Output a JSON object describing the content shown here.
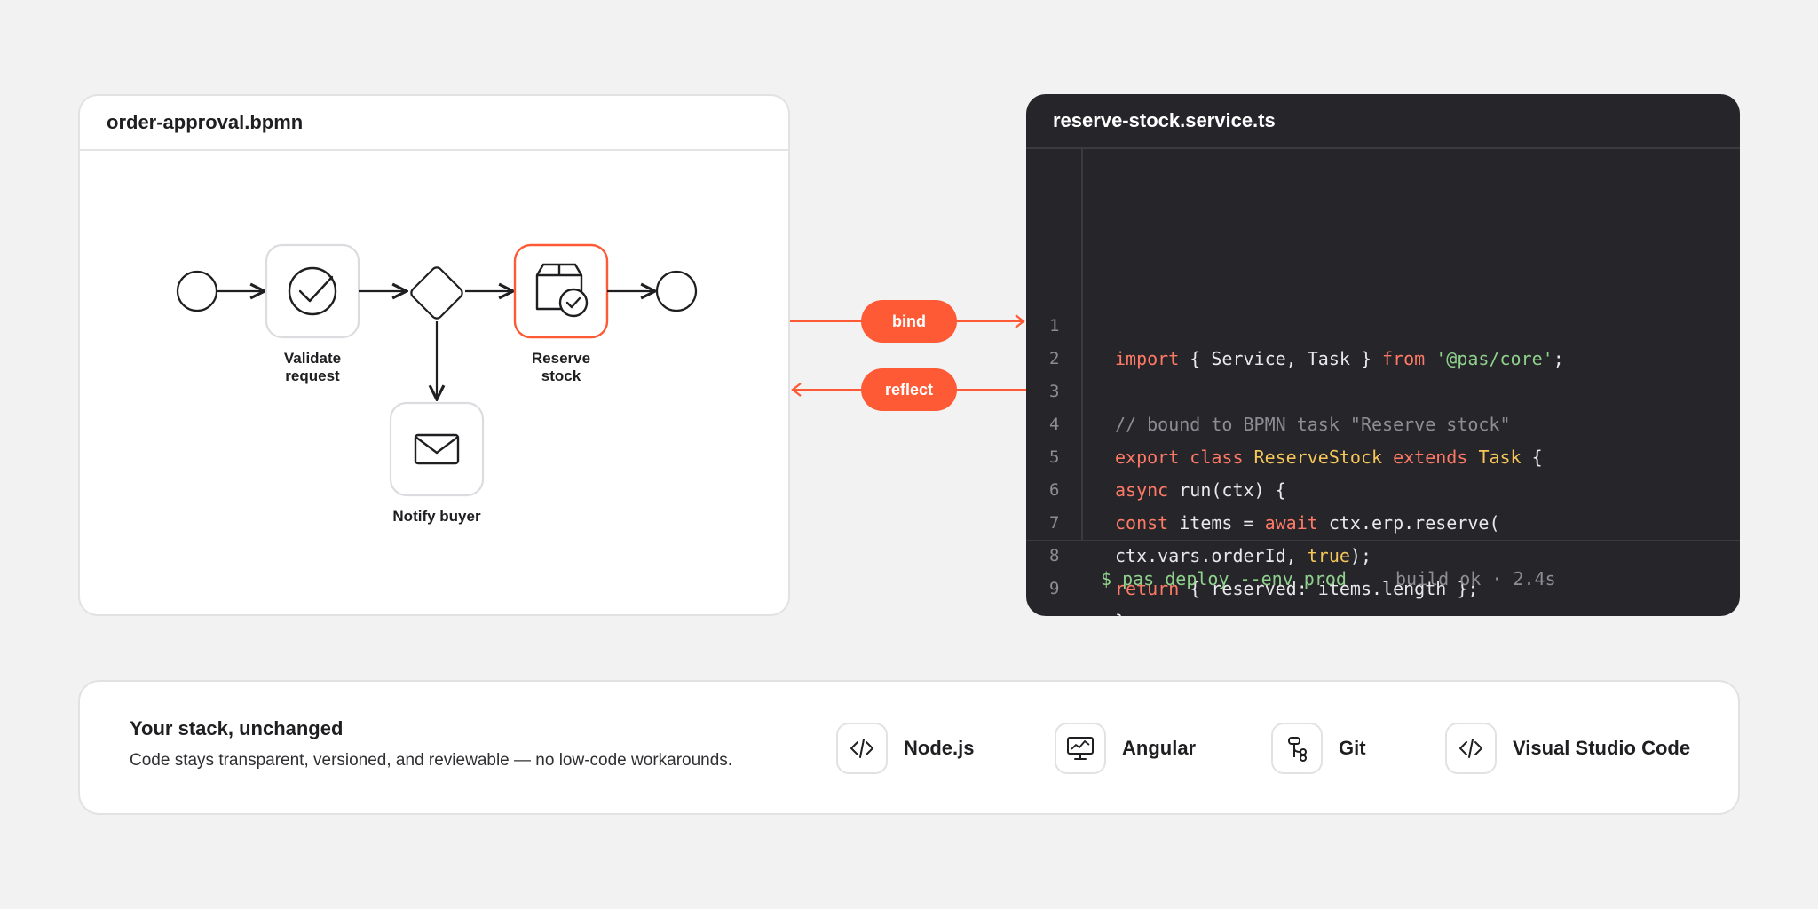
{
  "diagram": {
    "title": "order-approval.bpmn",
    "nodes": {
      "validate": "Validate\nrequest",
      "reserve": "Reserve\nstock",
      "notify": "Notify buyer"
    }
  },
  "connectors": {
    "bind_label": "bind",
    "reflect_label": "reflect"
  },
  "editor": {
    "title": "reserve-stock.service.ts",
    "line_numbers": [
      "1",
      "2",
      "3",
      "4",
      "5",
      "6",
      "7",
      "8",
      "9"
    ],
    "terminal_command": "$ pas deploy --env prod",
    "terminal_result": "build ok · 2.4s"
  },
  "footer": {
    "title": "Your stack, unchanged",
    "subtitle": "Code stays transparent, versioned, and reviewable — no low-code workarounds.",
    "tools": [
      {
        "label": "Node.js",
        "icon": "code-icon"
      },
      {
        "label": "Angular",
        "icon": "monitor-chart-icon"
      },
      {
        "label": "Git",
        "icon": "git-branch-icon"
      },
      {
        "label": "Visual Studio Code",
        "icon": "code-icon"
      }
    ]
  },
  "colors": {
    "accent": "#ff5a36",
    "dark_panel": "#26252a",
    "keyword": "#ff7a66",
    "type": "#f5c65a",
    "string": "#8fd18c"
  }
}
